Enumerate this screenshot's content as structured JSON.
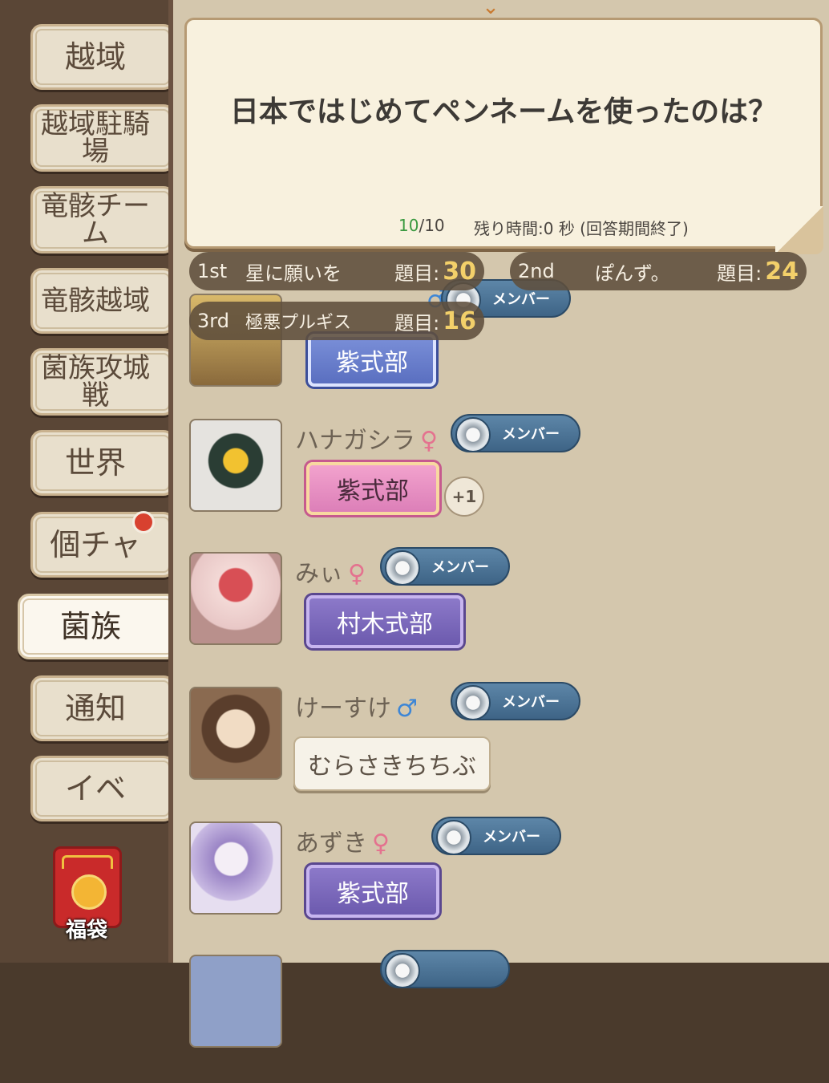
{
  "sidebar": {
    "tabs": [
      {
        "label": "越域"
      },
      {
        "label": "越域駐騎場"
      },
      {
        "label": "竜骸チーム"
      },
      {
        "label": "竜骸越域"
      },
      {
        "label": "菌族攻城戦"
      },
      {
        "label": "世界"
      },
      {
        "label": "個チャ",
        "has_notification": true
      },
      {
        "label": "菌族",
        "active": true
      },
      {
        "label": "通知"
      },
      {
        "label": "イベ"
      }
    ],
    "lucky_bag": {
      "label": "福袋"
    }
  },
  "quiz": {
    "question": "日本ではじめてペンネームを使ったのは？",
    "progress_current": "10",
    "progress_total": "/10",
    "timer": "残り時間:0 秒 (回答期間終了)"
  },
  "ranking": [
    {
      "pos": "1st",
      "name": "星に願いを",
      "label": "題目:",
      "score": "30"
    },
    {
      "pos": "2nd",
      "name": "ぽんず。",
      "label": "題目:",
      "score": "24"
    },
    {
      "pos": "3rd",
      "name": "極悪プルギス",
      "label": "題目:",
      "score": "16"
    }
  ],
  "members": [
    {
      "name": "",
      "gender": "♂",
      "role": "メンバー",
      "title": "紫式部",
      "plate": "blue"
    },
    {
      "name": "ハナガシラ",
      "gender": "♀",
      "role": "メンバー",
      "title": "紫式部",
      "extra": "+1",
      "plate": "pink"
    },
    {
      "name": "みぃ",
      "gender": "♀",
      "role": "メンバー",
      "title": "村木式部",
      "plate": "purple"
    },
    {
      "name": "けーすけ",
      "gender": "♂",
      "role": "メンバー",
      "title": "むらさきちちぶ",
      "plate": "plain"
    },
    {
      "name": "あずき",
      "gender": "♀",
      "role": "メンバー",
      "title": "紫式部",
      "plate": "purple"
    }
  ],
  "colors": {
    "sidebar_bg": "#5a4636",
    "list_bg": "#d4c7ad",
    "role_badge": "#4a7090",
    "score_gold": "#f3d06a"
  }
}
